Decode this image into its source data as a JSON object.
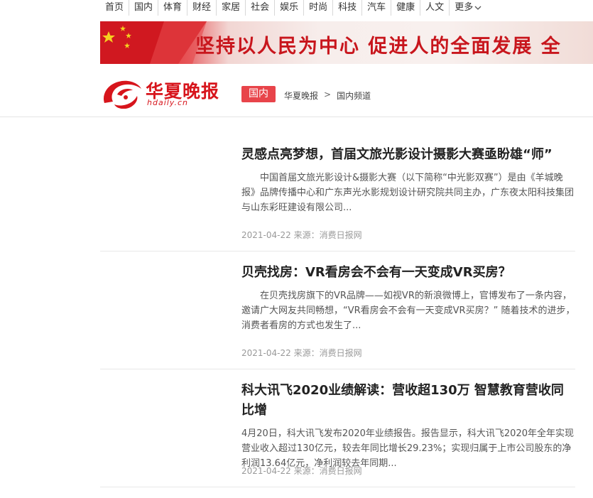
{
  "topnav": {
    "items": [
      "首页",
      "国内",
      "体育",
      "财经",
      "家居",
      "社会",
      "娱乐",
      "时尚",
      "科技",
      "汽车",
      "健康",
      "人文"
    ],
    "more_label": "更多"
  },
  "banner": {
    "slogan": "坚持以人民为中心  促进人的全面发展  全"
  },
  "logo": {
    "name": "华夏晚报",
    "domain": "hdaily.cn"
  },
  "channel": {
    "tag": "国内",
    "breadcrumb": [
      "华夏晚报",
      "国内频道"
    ],
    "breadcrumb_sep": ">"
  },
  "articles": [
    {
      "title": "灵感点亮梦想，首届文旅光影设计摄影大赛亟盼雄“师”",
      "summary": "中国首届文旅光影设计&摄影大赛（以下简称“中光影双赛”）是由《羊城晚报》品牌传播中心和广东声光水影规划设计研究院共同主办，广东夜太阳科技集团与山东彩旺建设有限公司...",
      "date": "2021-04-22",
      "source": "来源：消费日报网"
    },
    {
      "title": "贝壳找房：VR看房会不会有一天变成VR买房？",
      "summary": "在贝壳找房旗下的VR品牌——如视VR的新浪微博上，官博发布了一条内容，邀请广大网友共同畅想，“VR看房会不会有一天变成VR买房？” 随着技术的进步，消费者看房的方式也发生了...",
      "date": "2021-04-22",
      "source": "来源：消费日报网"
    },
    {
      "title": "科大讯飞2020业绩解读：营收超130万 智慧教育营收同比增",
      "summary": "4月20日，科大讯飞发布2020年业绩报告。报告显示，科大讯飞2020年全年实现营业收入超过130亿元，较去年同比增长29.23%；实现归属于上市公司股东的净利润13.64亿元，净利润较去年同期...",
      "date": "2021-04-22",
      "source": "来源：消费日报网"
    }
  ]
}
